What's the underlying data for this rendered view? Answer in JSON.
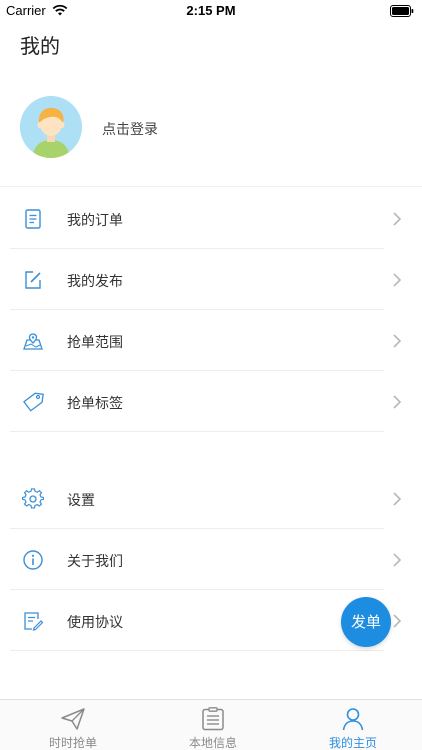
{
  "status_bar": {
    "carrier": "Carrier",
    "time": "2:15 PM"
  },
  "page": {
    "title": "我的"
  },
  "profile": {
    "login_text": "点击登录"
  },
  "menu_group_1": [
    {
      "label": "我的订单",
      "icon": "order-list-icon"
    },
    {
      "label": "我的发布",
      "icon": "edit-icon"
    },
    {
      "label": "抢单范围",
      "icon": "map-range-icon"
    },
    {
      "label": "抢单标签",
      "icon": "tag-icon"
    }
  ],
  "menu_group_2": [
    {
      "label": "设置",
      "icon": "gear-icon"
    },
    {
      "label": "关于我们",
      "icon": "info-icon"
    },
    {
      "label": "使用协议",
      "icon": "agreement-icon"
    }
  ],
  "fab": {
    "label": "发单"
  },
  "tabbar": [
    {
      "label": "时时抢单",
      "icon": "paper-plane-icon",
      "active": false
    },
    {
      "label": "本地信息",
      "icon": "clipboard-icon",
      "active": false
    },
    {
      "label": "我的主页",
      "icon": "person-icon",
      "active": true
    }
  ],
  "colors": {
    "accent": "#2f8fe0",
    "fab": "#1c8de0",
    "avatar_bg": "#aee0f5"
  }
}
